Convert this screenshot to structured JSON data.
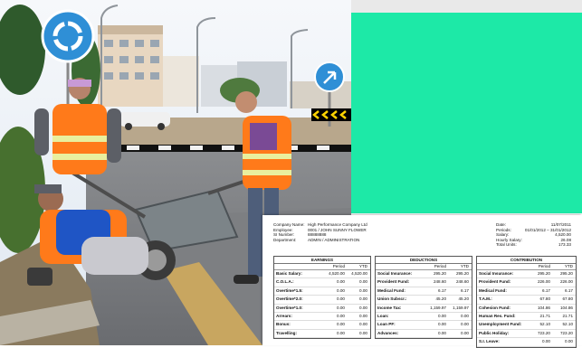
{
  "colors": {
    "teal": "#1de9a7",
    "sky": "#e4eef6"
  },
  "photo": {
    "icons": [
      "roundabout-sign-icon",
      "keep-right-sign-icon",
      "chevron-warning-sign-icon"
    ]
  },
  "payslip": {
    "left_labels": [
      "Company Name:",
      "Employee:",
      "SI Number:",
      "Department:"
    ],
    "left_values": [
      "High Performance Company Ltd",
      "0001    /  JOHN SUNNY FLOWER",
      "88888888",
      "ADMIN / ADMINISTRATION"
    ],
    "right_labels": [
      "Date:",
      "Periods:",
      "Salary:",
      "Hourly Salary:",
      "Total Units:"
    ],
    "right_values": [
      "11/07/2011",
      "01/01/2012 – 31/01/2012",
      "4,520.00",
      "26.08",
      "173.33"
    ],
    "sections": [
      {
        "title": "EARNINGS",
        "col_a": "Period",
        "col_b": "YTD",
        "rows": [
          {
            "label": "Basic Salary:",
            "a": "4,520.00",
            "b": "4,520.00"
          },
          {
            "label": "C.O.L.A.:",
            "a": "0.00",
            "b": "0.00"
          },
          {
            "label": "Overtime*1.5:",
            "a": "0.00",
            "b": "0.00"
          },
          {
            "label": "Overtime*2.0:",
            "a": "0.00",
            "b": "0.00"
          },
          {
            "label": "Overtime*1.0:",
            "a": "0.00",
            "b": "0.00"
          },
          {
            "label": "Arrears:",
            "a": "0.00",
            "b": "0.00"
          },
          {
            "label": "Bonus:",
            "a": "0.00",
            "b": "0.00"
          },
          {
            "label": "Travelling:",
            "a": "0.00",
            "b": "0.00"
          }
        ]
      },
      {
        "title": "DEDUCTIONS",
        "col_a": "Period",
        "col_b": "YTD",
        "rows": [
          {
            "label": "Social Insurance:",
            "a": "295.20",
            "b": "295.20"
          },
          {
            "label": "Provident Fund:",
            "a": "248.60",
            "b": "248.60"
          },
          {
            "label": "Medical Fund:",
            "a": "6.17",
            "b": "6.17"
          },
          {
            "label": "Union Subscr.:",
            "a": "45.20",
            "b": "45.20"
          },
          {
            "label": "Income Tax:",
            "a": "1,159.97",
            "b": "1,159.97"
          },
          {
            "label": "Loan:",
            "a": "0.00",
            "b": "0.00"
          },
          {
            "label": "Loan PF:",
            "a": "0.00",
            "b": "0.00"
          },
          {
            "label": "Advances:",
            "a": "0.00",
            "b": "0.00"
          }
        ]
      },
      {
        "title": "CONTRIBUTION",
        "col_a": "Period",
        "col_b": "YTD",
        "rows": [
          {
            "label": "Social Insurance:",
            "a": "295.20",
            "b": "295.20"
          },
          {
            "label": "Provident Fund:",
            "a": "226.00",
            "b": "226.00"
          },
          {
            "label": "Medical Fund:",
            "a": "6.17",
            "b": "6.17"
          },
          {
            "label": "T.A.M.:",
            "a": "67.80",
            "b": "67.80"
          },
          {
            "label": "Cohesion Fund:",
            "a": "104.86",
            "b": "104.86"
          },
          {
            "label": "Human Res. Fund:",
            "a": "21.71",
            "b": "21.71"
          },
          {
            "label": "Unemployment Fund:",
            "a": "52.10",
            "b": "52.10"
          },
          {
            "label": "Public Holiday:",
            "a": "723.20",
            "b": "723.20"
          },
          {
            "label": "S.I. Leave:",
            "a": "0.00",
            "b": "0.00"
          }
        ]
      }
    ]
  }
}
